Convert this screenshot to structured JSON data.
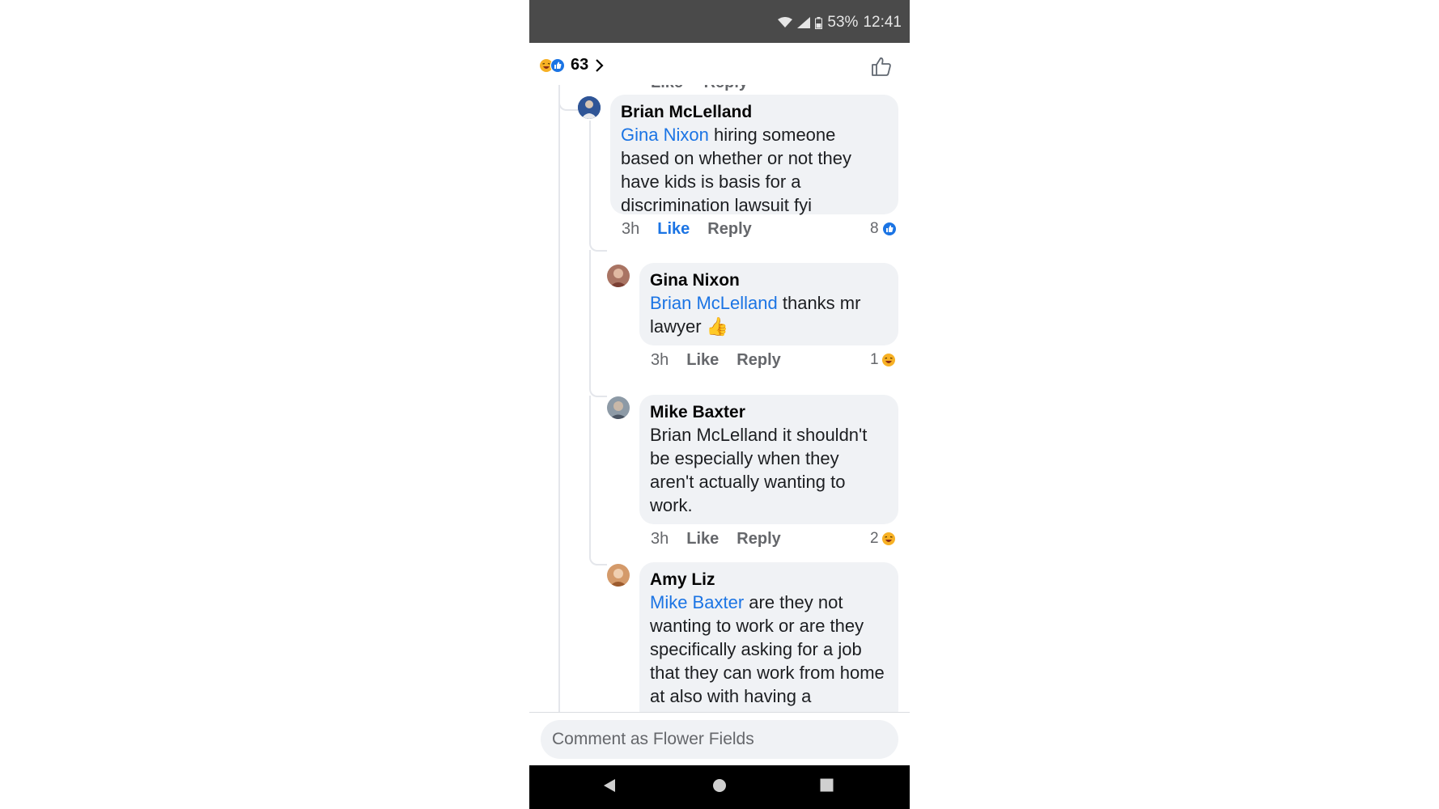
{
  "status_bar": {
    "battery": "53%",
    "time": "12:41"
  },
  "reactions_summary": {
    "count": "63",
    "icons": [
      "haha-icon",
      "like-icon"
    ]
  },
  "composer": {
    "placeholder": "Comment as Flower Fields"
  },
  "comments": [
    {
      "author": "Brian McLelland",
      "mention": "Gina Nixon",
      "text": " hiring someone based on whether or not they have kids is basis for a discrimination lawsuit fyi",
      "time": "3h",
      "like_label": "Like",
      "reply_label": "Reply",
      "liked": true,
      "reaction_count": "8",
      "reaction_icon": "like-icon"
    },
    {
      "author": "Gina Nixon",
      "mention": "Brian McLelland",
      "text": " thanks mr lawyer 👍",
      "time": "3h",
      "like_label": "Like",
      "reply_label": "Reply",
      "liked": false,
      "reaction_count": "1",
      "reaction_icon": "haha-icon"
    },
    {
      "author": "Mike Baxter",
      "mention": "",
      "text": "Brian McLelland it shouldn't be especially when they aren't actually wanting to work.",
      "time": "3h",
      "like_label": "Like",
      "reply_label": "Reply",
      "liked": false,
      "reaction_count": "2",
      "reaction_icon": "haha-icon"
    },
    {
      "author": "Amy Liz",
      "mention": "Mike Baxter",
      "text": " are they not wanting to work or are they specifically asking for a job that they can work from home at also with having a",
      "time": "",
      "like_label": "",
      "reply_label": "",
      "liked": false,
      "reaction_count": "",
      "reaction_icon": ""
    }
  ],
  "previous_comment_meta": {
    "like_label": "Like",
    "reply_label": "Reply"
  },
  "colors": {
    "link_blue": "#1b74e4",
    "bubble_bg": "#f0f2f5",
    "meta_gray": "#65676b"
  }
}
